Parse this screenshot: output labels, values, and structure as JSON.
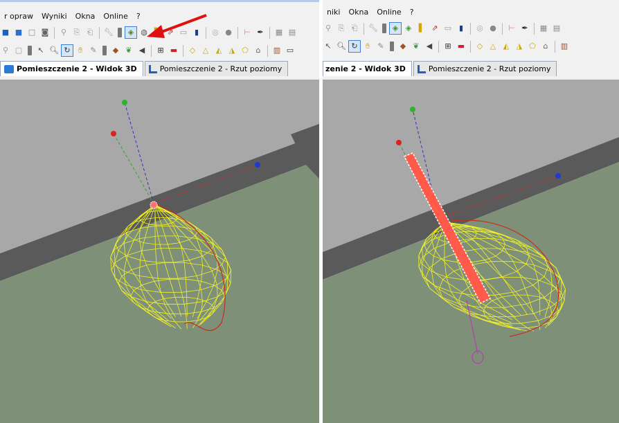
{
  "left": {
    "menu": [
      "r opraw",
      "Wyniki",
      "Okna",
      "Online",
      "?"
    ],
    "tabs": [
      {
        "label": "Pomieszczenie 2 - Widok 3D",
        "active": true
      },
      {
        "label": "Pomieszczenie 2 - Rzut poziomy",
        "active": false
      }
    ],
    "toolbar1_icons": [
      "box-blue-icon",
      "box-blue-2-icon",
      "box-white-icon",
      "preview-icon",
      "link-icon",
      "copy-icon",
      "paste-icon",
      "wrench-icon",
      "lamp-icon",
      "paint-icon",
      "compass-icon",
      "select-icon",
      "luminaire-icon",
      "grid-icon"
    ],
    "toolbar2_icons": [
      "stamp-icon",
      "page-icon",
      "cursor-icon",
      "zoom-icon",
      "rotate-icon",
      "pan-icon",
      "measure-icon",
      "bucket-icon",
      "leaf-icon",
      "arrow-icon",
      "calc-icon",
      "folder-icon",
      "shape-a-icon",
      "shape-b-icon",
      "shape-c-icon",
      "shape-d-icon",
      "shape-e-icon",
      "house-icon",
      "film-icon",
      "frame-icon"
    ]
  },
  "right": {
    "menu": [
      "niki",
      "Okna",
      "Online",
      "?"
    ],
    "tabs": [
      {
        "label": "zenie 2 - Widok 3D",
        "active": true
      },
      {
        "label": "Pomieszczenie 2 - Rzut poziomy",
        "active": false
      }
    ],
    "toolbar1_icons": [
      "link-icon",
      "copy-icon",
      "paste-icon",
      "wrench-icon",
      "lamp-icon",
      "luminaire-icon",
      "paint-icon",
      "compass-icon",
      "select-icon",
      "circle-icon",
      "circle-2-icon",
      "tool-icon",
      "pen-icon",
      "grid-icon",
      "grid-2-icon"
    ],
    "toolbar2_icons": [
      "cursor-icon",
      "zoom-icon",
      "rotate-icon",
      "pan-icon",
      "measure-icon",
      "bucket-icon",
      "leaf-icon",
      "arrow-icon",
      "calc-icon",
      "folder-icon",
      "shape-a-icon",
      "shape-b-icon",
      "shape-c-icon",
      "shape-d-icon",
      "shape-e-icon",
      "house-icon",
      "film-icon"
    ]
  },
  "colors": {
    "ceiling": "#a8a8a8",
    "wall_edge": "#5a5a5a",
    "floor": "#7f9079",
    "wireframe": "#f2f22a",
    "curve": "#cc2a1a",
    "beam": "#ff5a4a",
    "annotation_arrow": "#e01010"
  }
}
